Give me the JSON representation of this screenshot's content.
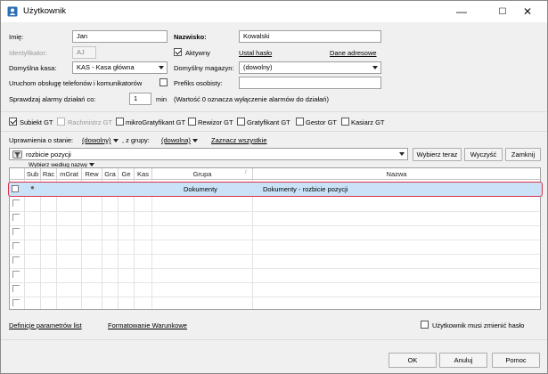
{
  "window": {
    "title": "Użytkownik",
    "minimize": "—",
    "maximize": "☐",
    "close": "✕"
  },
  "form": {
    "imie_label": "Imię:",
    "imie_value": "Jan",
    "nazwisko_label": "Nazwisko:",
    "nazwisko_value": "Kowalski",
    "identyfikator_label": "Identyfikator:",
    "identyfikator_value": "AJ",
    "aktywny_label": "Aktywny",
    "aktywny_checked": true,
    "ustal_haslo": "Ustal hasło",
    "dane_adresowe": "Dane adresowe",
    "kasa_label": "Domyślna kasa:",
    "kasa_value": "KAS - Kasa główna",
    "magazyn_label": "Domyślny magazyn:",
    "magazyn_value": "(dowolny)",
    "uruchom_label": "Uruchom obsługę telefonów i komunikatorów",
    "uruchom_checked": false,
    "prefiks_label": "Prefiks osobisty:",
    "prefiks_value": "",
    "alarmy_label": "Sprawdzaj alarmy działań co:",
    "alarmy_value": "1",
    "alarmy_unit": "min",
    "alarmy_note": "(Wartość 0 oznacza wyłączenie alarmów do działań)"
  },
  "roles": [
    {
      "label": "Subiekt GT",
      "checked": true,
      "enabled": true
    },
    {
      "label": "Rachmistrz GT",
      "checked": false,
      "enabled": false
    },
    {
      "label": "mikroGratyfikant GT",
      "checked": false,
      "enabled": true
    },
    {
      "label": "Rewizor GT",
      "checked": false,
      "enabled": true
    },
    {
      "label": "Gratyfikant GT",
      "checked": false,
      "enabled": true
    },
    {
      "label": "Gestor GT",
      "checked": false,
      "enabled": true
    },
    {
      "label": "Kasiarz GT",
      "checked": false,
      "enabled": true
    }
  ],
  "permissions": {
    "stan_label": "Uprawnienia o stanie:",
    "stan_value": "(dowolny)",
    "grupa_label": ", z grupy:",
    "grupa_value": "(dowolna)",
    "zaznacz": "Zaznacz wszystkie",
    "filter_value": "rozbicie pozycji",
    "btn_wybierz": "Wybierz teraz",
    "btn_wyczysc": "Wyczyść",
    "btn_zamknij": "Zamknij",
    "wybierz_wg": "Wybierz według nazwy"
  },
  "table": {
    "columns": [
      "",
      "Sub",
      "Rac",
      "mGrat",
      "Rew",
      "Gra",
      "Ge",
      "Kas",
      "Grupa",
      "Nazwa"
    ],
    "rows": [
      {
        "sub": "●",
        "grupa": "Dokumenty",
        "nazwa": "Dokumenty - rozbicie pozycji",
        "selected": true
      }
    ],
    "empty_rows": 8
  },
  "bottom": {
    "definicje": "Definicje parametrów list",
    "formatowanie": "Formatowanie Warunkowe",
    "musi_zmienic": "Użytkownik musi zmienić hasło"
  },
  "footer": {
    "ok": "OK",
    "anuluj": "Anuluj",
    "pomoc": "Pomoc"
  },
  "colors": {
    "accent": "#1a5fb4",
    "selected_row": "#c9e2f7",
    "highlight_border": "#d9334a"
  }
}
